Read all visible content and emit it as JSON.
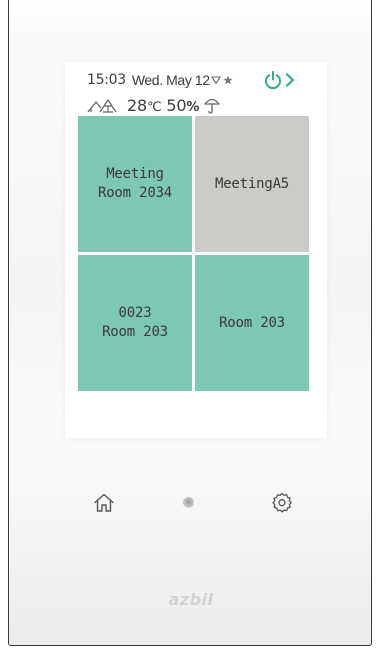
{
  "status": {
    "time": "15:03",
    "date": "Wed. May 12",
    "temperature": "28",
    "temperature_unit": "℃",
    "humidity": "50",
    "humidity_unit": "%"
  },
  "rooms": [
    {
      "label": "Meeting\nRoom 2034",
      "color": "#7ec8b3"
    },
    {
      "label": "MeetingA5",
      "color": "#cdcbc8"
    },
    {
      "label": "0023\nRoom 203",
      "color": "#7ec8b3"
    },
    {
      "label": "Room 203",
      "color": "#7ec8b3"
    }
  ],
  "icons": {
    "triangle": "triangle-down-icon",
    "star": "star-icon",
    "power": "power-icon",
    "next": "chevron-right-icon",
    "environment": "outdoor-indoor-icon",
    "umbrella": "umbrella-icon",
    "home": "home-icon",
    "indicator": "indicator-dot",
    "settings": "gear-icon"
  },
  "brand": "azbil",
  "colors": {
    "accent": "#2fae8c",
    "tile_green": "#7ec8b3",
    "tile_gray": "#cdcbc8",
    "text": "#3a3a3a",
    "icon": "#555555"
  }
}
